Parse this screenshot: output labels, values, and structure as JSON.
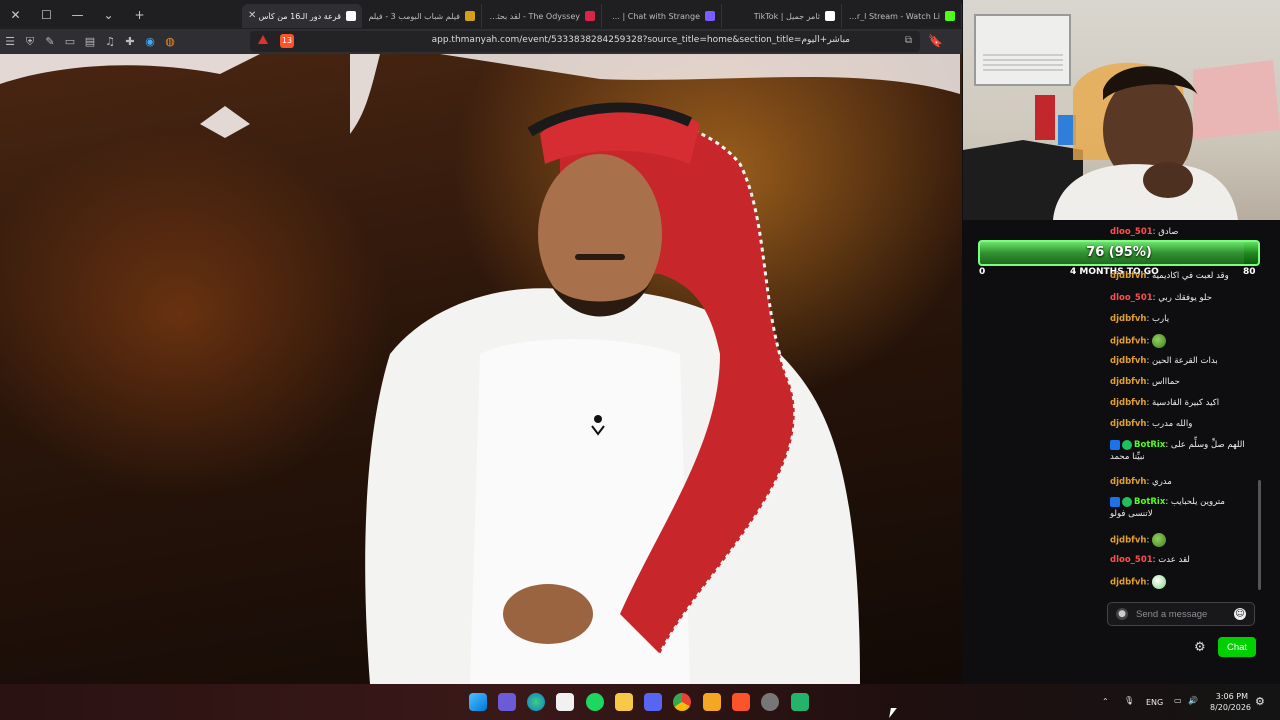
{
  "browser": {
    "tabs": [
      {
        "title": "Thamer_l Stream - Watch Li",
        "icon": "kick-icon",
        "color": "#53fc18"
      },
      {
        "title": "ثامر جميل | TikTok",
        "icon": "tiktok-icon",
        "color": "#ffffff"
      },
      {
        "title": "Umingle | Chat with Strange",
        "icon": "umingle-icon",
        "color": "#7b5cff"
      },
      {
        "title": "The Odyssey - لقد بحثت عن",
        "icon": "odyssey-icon",
        "color": "#d9254b"
      },
      {
        "title": "فيلم شباب البومب 3 - فيلم",
        "icon": "film-icon",
        "color": "#d4a017"
      },
      {
        "title": "قرعة دور الـ16 من كأس",
        "icon": "thmanyah-icon",
        "color": "#ffffff"
      }
    ],
    "url": "app.thmanyah.com/event/5333838284259328?source_title=home&section_title=مباشر+اليوم",
    "brave_shield_count": "13"
  },
  "goal": {
    "text": "76 (95%)",
    "progress_percent": 95,
    "min": "0",
    "max": "80",
    "subtitle": "4 MONTHS TO GO"
  },
  "chat": {
    "messages": [
      {
        "user": "dloo_501",
        "user_color": "#ff4d4d",
        "text": "صادق"
      },
      {
        "user": "djdbfvh",
        "user_color": "#e0a030",
        "text": "وقد لعبت في اكاديمية"
      },
      {
        "user": "dloo_501",
        "user_color": "#ff4d4d",
        "text": "حلو يوفقك ربي"
      },
      {
        "user": "djdbfvh",
        "user_color": "#e0a030",
        "text": "يارب"
      },
      {
        "user": "djdbfvh",
        "user_color": "#e0a030",
        "text": "",
        "emote": "pepe"
      },
      {
        "user": "djdbfvh",
        "user_color": "#e0a030",
        "text": "بدات القرعة الحين"
      },
      {
        "user": "djdbfvh",
        "user_color": "#e0a030",
        "text": "حماااس"
      },
      {
        "user": "djdbfvh",
        "user_color": "#e0a030",
        "text": "اكيد كبيرة القادسية"
      },
      {
        "user": "djdbfvh",
        "user_color": "#e0a030",
        "text": "والله مدرب"
      },
      {
        "user": "BotRix",
        "user_color": "#53fc18",
        "text": "اللهم صلِّ وسلِّم على نبيِّنا محمد",
        "bot": true
      },
      {
        "user": "djdbfvh",
        "user_color": "#e0a030",
        "text": "مدري"
      },
      {
        "user": "BotRix",
        "user_color": "#53fc18",
        "text": "متروين يلحبايب لاتنسى فولو",
        "bot": true
      },
      {
        "user": "djdbfvh",
        "user_color": "#e0a030",
        "text": "",
        "emote": "pepe"
      },
      {
        "user": "dloo_501",
        "user_color": "#ff4d4d",
        "text": "لقد عدت"
      },
      {
        "user": "djdbfvh",
        "user_color": "#e0a030",
        "text": "",
        "emote": "ghost"
      }
    ],
    "input_placeholder": "Send a message",
    "send_label": "Chat"
  },
  "taskbar": {
    "lang": "ENG",
    "time": "3:06 PM",
    "date": "8/20/2026"
  }
}
